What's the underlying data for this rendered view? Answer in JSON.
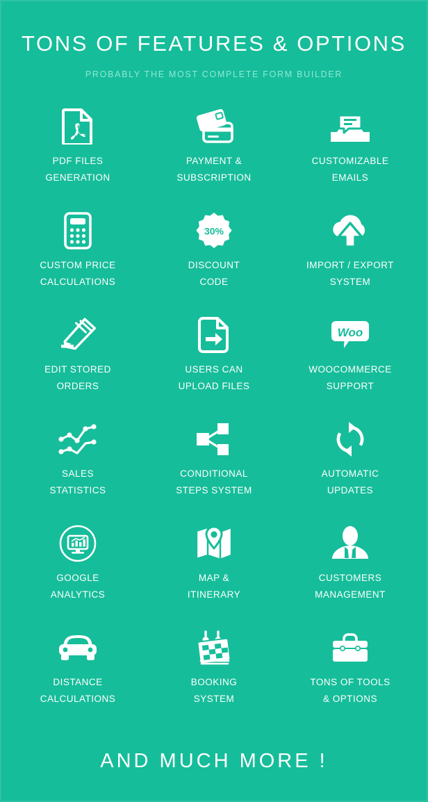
{
  "theme": {
    "background": "#16bd9a",
    "icon_color": "#ffffff",
    "title_color": "#ffffff",
    "subtitle_color": "#8fe9d5",
    "badge_text_color": "#16bd9a"
  },
  "header": {
    "title": "TONS OF FEATURES & OPTIONS",
    "subtitle": "PROBABLY THE MOST COMPLETE FORM BUILDER"
  },
  "features": [
    {
      "icon": "pdf-file-icon",
      "line1": "PDF FILES",
      "line2": "GENERATION"
    },
    {
      "icon": "credit-cards-icon",
      "line1": "PAYMENT &",
      "line2": "SUBSCRIPTION"
    },
    {
      "icon": "email-envelope-icon",
      "line1": "CUSTOMIZABLE",
      "line2": "EMAILS"
    },
    {
      "icon": "calculator-icon",
      "line1": "CUSTOM PRICE",
      "line2": "CALCULATIONS"
    },
    {
      "icon": "discount-badge-icon",
      "line1": "DISCOUNT",
      "line2": "CODE"
    },
    {
      "icon": "cloud-upload-icon",
      "line1": "IMPORT / EXPORT",
      "line2": "SYSTEM"
    },
    {
      "icon": "pencil-edit-icon",
      "line1": "EDIT STORED",
      "line2": "ORDERS"
    },
    {
      "icon": "file-upload-arrow-icon",
      "line1": "USERS CAN",
      "line2": "UPLOAD FILES"
    },
    {
      "icon": "woocommerce-logo-icon",
      "line1": "WOOCOMMERCE",
      "line2": "SUPPORT"
    },
    {
      "icon": "line-chart-icon",
      "line1": "SALES",
      "line2": "STATISTICS"
    },
    {
      "icon": "share-nodes-icon",
      "line1": "CONDITIONAL",
      "line2": "STEPS SYSTEM"
    },
    {
      "icon": "refresh-cycle-icon",
      "line1": "AUTOMATIC",
      "line2": "UPDATES"
    },
    {
      "icon": "analytics-monitor-icon",
      "line1": "GOOGLE",
      "line2": "ANALYTICS"
    },
    {
      "icon": "map-pin-icon",
      "line1": "MAP &",
      "line2": "ITINERARY"
    },
    {
      "icon": "business-person-icon",
      "line1": "CUSTOMERS",
      "line2": "MANAGEMENT"
    },
    {
      "icon": "car-icon",
      "line1": "DISTANCE",
      "line2": "CALCULATIONS"
    },
    {
      "icon": "calendar-booking-icon",
      "line1": "BOOKING",
      "line2": "SYSTEM"
    },
    {
      "icon": "toolbox-icon",
      "line1": "TONS OF TOOLS",
      "line2": "& OPTIONS"
    }
  ],
  "badges": {
    "discount_percent": "30%",
    "woocommerce_wordmark": "Woo"
  },
  "footer": {
    "text": "AND MUCH MORE !"
  }
}
